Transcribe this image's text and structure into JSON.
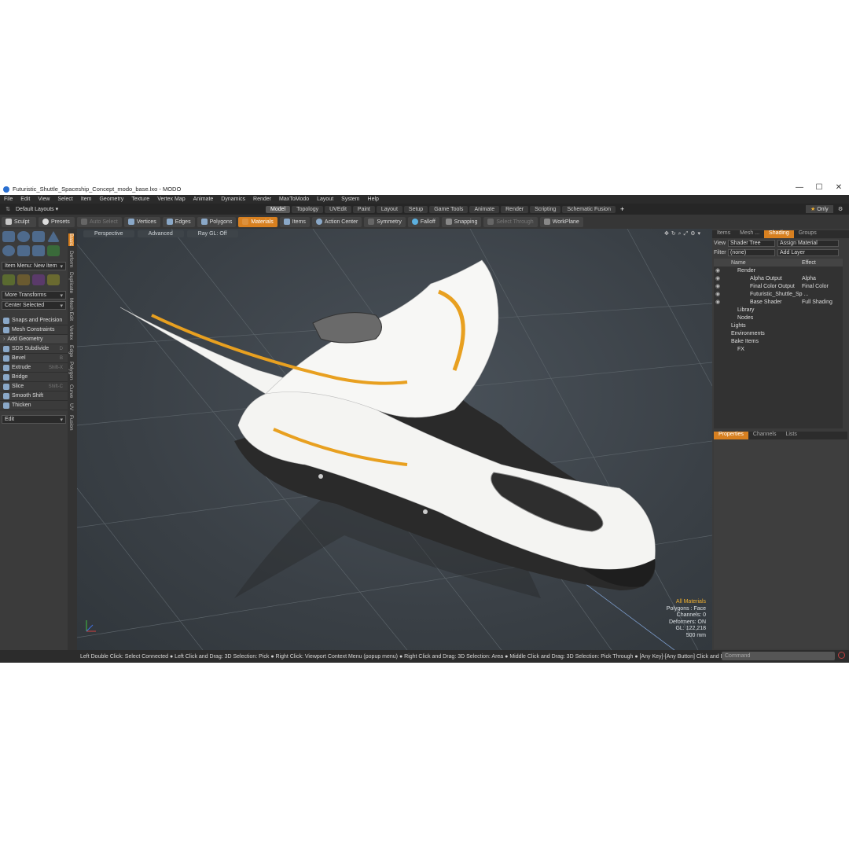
{
  "window": {
    "title": "Futuristic_Shuttle_Spaceship_Concept_modo_base.lxo - MODO",
    "minimize": "—",
    "maximize": "☐",
    "close": "✕"
  },
  "menu": [
    "File",
    "Edit",
    "View",
    "Select",
    "Item",
    "Geometry",
    "Texture",
    "Vertex Map",
    "Animate",
    "Dynamics",
    "Render",
    "MaxToModo",
    "Layout",
    "System",
    "Help"
  ],
  "layouts": {
    "label": "Default Layouts",
    "tabs": [
      "Model",
      "Topology",
      "UVEdit",
      "Paint",
      "Layout",
      "Setup",
      "Game Tools",
      "Animate",
      "Render",
      "Scripting",
      "Schematic Fusion"
    ],
    "active": "Model",
    "add": "+",
    "only": "Only"
  },
  "toolbar": {
    "sculpt": "Sculpt",
    "presets": "Presets",
    "buttons": [
      "Auto Select",
      "Vertices",
      "Edges",
      "Polygons",
      "Materials",
      "Items",
      "Action Center",
      "Symmetry",
      "Falloff",
      "Snapping",
      "Select Through",
      "WorkPlane"
    ]
  },
  "left_panel": {
    "item_menu": "Item Menu: New Item",
    "more_transforms": "More Transforms",
    "center_selected": "Center Selected",
    "rows": [
      {
        "label": "Snaps and Precision",
        "shortcut": ""
      },
      {
        "label": "Mesh Constraints",
        "shortcut": ""
      },
      {
        "label": "Add Geometry",
        "shortcut": ""
      },
      {
        "label": "SDS Subdivide",
        "shortcut": "D"
      },
      {
        "label": "Bevel",
        "shortcut": "B"
      },
      {
        "label": "Extrude",
        "shortcut": "Shift-X"
      },
      {
        "label": "Bridge",
        "shortcut": ""
      },
      {
        "label": "Slice",
        "shortcut": "Shift-C"
      },
      {
        "label": "Smooth Shift",
        "shortcut": ""
      },
      {
        "label": "Thicken",
        "shortcut": ""
      }
    ],
    "edit": "Edit",
    "vtabs": [
      "Basic",
      "Deform",
      "Duplicate",
      "Mesh Edit",
      "Vertex",
      "Edge",
      "Polygon",
      "Curve",
      "UV",
      "Fusion"
    ]
  },
  "viewport": {
    "tabs": [
      "Perspective",
      "Advanced",
      "Ray GL: Off"
    ],
    "stats": [
      "All Materials",
      "Polygons : Face",
      "Channels: 0",
      "Deformers: ON",
      "GL: 122,218",
      "500 mm"
    ]
  },
  "right_panel": {
    "tabs": [
      "Items",
      "Mesh ...",
      "Shading",
      "Groups"
    ],
    "view_label": "View",
    "view_value": "Shader Tree",
    "assign": "Assign Material",
    "filter_label": "Filter",
    "filter_value": "(none)",
    "add_layer": "Add Layer",
    "col_name": "Name",
    "col_effect": "Effect",
    "tree": [
      {
        "name": "Render",
        "effect": "",
        "indent": 0
      },
      {
        "name": "Alpha Output",
        "effect": "Alpha",
        "indent": 1
      },
      {
        "name": "Final Color Output",
        "effect": "Final Color",
        "indent": 1
      },
      {
        "name": "Futuristic_Shuttle_Sp ...",
        "effect": "",
        "indent": 1
      },
      {
        "name": "Base Shader",
        "effect": "Full Shading",
        "indent": 1
      },
      {
        "name": "Library",
        "effect": "",
        "indent": 0
      },
      {
        "name": "Nodes",
        "effect": "",
        "indent": 0
      },
      {
        "name": "Lights",
        "effect": "",
        "indent": 0
      },
      {
        "name": "Environments",
        "effect": "",
        "indent": 0
      },
      {
        "name": "Bake Items",
        "effect": "",
        "indent": 0
      },
      {
        "name": "FX",
        "effect": "",
        "indent": 0
      }
    ],
    "prop_tabs": [
      "Properties",
      "Channels",
      "Lists"
    ]
  },
  "statusbar": "Left Double Click: Select Connected ● Left Click and Drag: 3D Selection: Pick ● Right Click: Viewport Context Menu (popup menu) ● Right Click and Drag: 3D Selection: Area ● Middle Click and Drag: 3D Selection: Pick Through ● [Any Key]-[Any Button] Click and Drag: dragDropBegin",
  "command_placeholder": "Command",
  "colors": {
    "accent": "#d88020",
    "background": "#2f2f2f",
    "viewport": "#3a4046",
    "hull": "#f4f4f2",
    "stripe": "#e8a020"
  }
}
